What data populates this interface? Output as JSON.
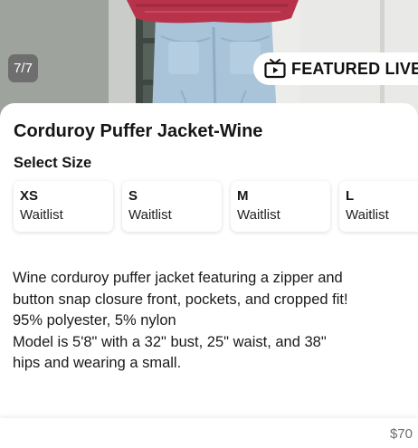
{
  "gallery": {
    "counter": "7/7",
    "badge_label": "FEATURED LIVE",
    "badge_icon": "tv-play-icon"
  },
  "product": {
    "title": "Corduroy Puffer Jacket-Wine",
    "select_size_label": "Select Size",
    "sizes": [
      {
        "label": "XS",
        "status": "Waitlist"
      },
      {
        "label": "S",
        "status": "Waitlist"
      },
      {
        "label": "M",
        "status": "Waitlist"
      },
      {
        "label": "L",
        "status": "Waitlist"
      }
    ],
    "description_lines": [
      "Wine corduroy puffer jacket featuring a zipper and",
      "button snap closure front, pockets, and cropped fit!",
      "95% polyester, 5% nylon",
      "Model is 5'8\" with a 32\" bust, 25\" waist, and 38\"",
      "hips and wearing a small."
    ]
  },
  "footer": {
    "price": "$70"
  },
  "colors": {
    "jacket_wine": "#b8334a",
    "denim": "#a9c3d8",
    "text": "#161616",
    "price_gray": "#6d6d6d"
  }
}
